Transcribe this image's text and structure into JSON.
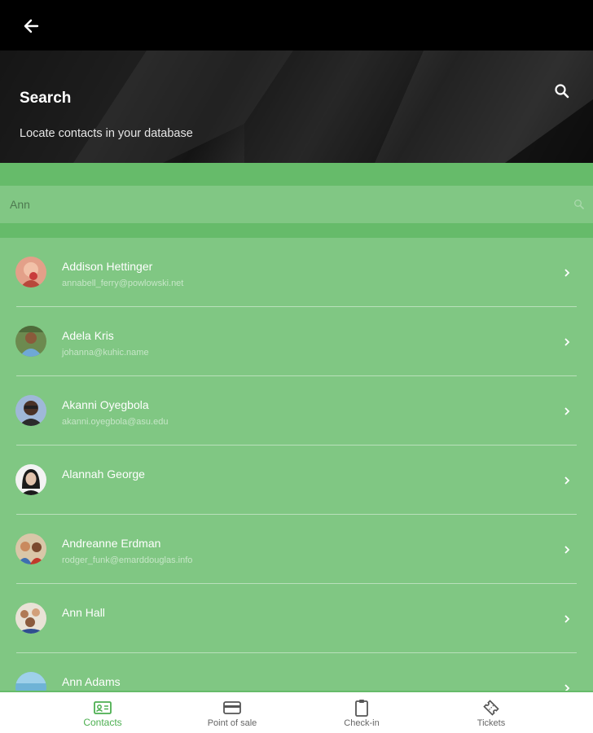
{
  "header": {
    "back_icon": "arrow-left-icon",
    "title": "Search",
    "subtitle": "Locate contacts in your database",
    "search_icon": "search-icon"
  },
  "search": {
    "value": "Ann",
    "placeholder": "Ann"
  },
  "contacts": [
    {
      "name": "Addison Hettinger",
      "email": "annabell_ferry@powlowski.net"
    },
    {
      "name": "Adela Kris",
      "email": "johanna@kuhic.name"
    },
    {
      "name": "Akanni Oyegbola",
      "email": "akanni.oyegbola@asu.edu"
    },
    {
      "name": "Alannah George",
      "email": ""
    },
    {
      "name": "Andreanne Erdman",
      "email": "rodger_funk@emarddouglas.info"
    },
    {
      "name": "Ann Hall",
      "email": ""
    },
    {
      "name": "Ann Adams",
      "email": ""
    }
  ],
  "nav": {
    "items": [
      {
        "label": "Contacts",
        "icon": "contact-card-icon",
        "active": true
      },
      {
        "label": "Point of sale",
        "icon": "credit-card-icon",
        "active": false
      },
      {
        "label": "Check-in",
        "icon": "clipboard-icon",
        "active": false
      },
      {
        "label": "Tickets",
        "icon": "ticket-icon",
        "active": false
      }
    ]
  },
  "colors": {
    "primary_green": "#66bb6a",
    "list_green": "#80c783",
    "active_nav": "#4caf50",
    "topbar": "#000000"
  }
}
